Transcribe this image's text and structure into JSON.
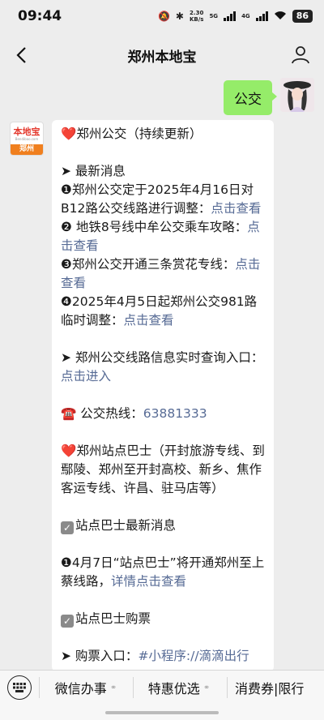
{
  "status": {
    "time": "09:44",
    "net_speed_top": "2.30",
    "net_speed_bottom": "KB/s",
    "sig1": "5G",
    "sig2": "4G",
    "battery": "86"
  },
  "nav": {
    "title": "郑州本地宝"
  },
  "user_message": {
    "text": "公交"
  },
  "bot_avatar": {
    "brand": "本地宝",
    "url": "Bendibao.com",
    "city": "郑州"
  },
  "message": {
    "title": "郑州公交（持续更新）",
    "section1": "最新消息",
    "news": [
      {
        "num": "❶",
        "text": "郑州公交定于2025年4月16日对B12路公交线路进行调整：",
        "link": "点击查看"
      },
      {
        "num": "❷",
        "text": "地铁8号线中牟公交乘车攻略：",
        "link": "点击查看"
      },
      {
        "num": "❸",
        "text": "郑州公交开通三条赏花专线：",
        "link": "点击查看"
      },
      {
        "num": "❹",
        "text": "2025年4月5日起郑州公交981路临时调整：",
        "link": "点击查看"
      }
    ],
    "query_text": "郑州公交线路信息实时查询入口：",
    "query_link": "点击进入",
    "hotline_label": "公交热线：",
    "hotline_number": "63881333",
    "bus_title": "郑州站点巴士（开封旅游专线、到鄢陵、郑州至开封高校、新乡、焦作客运专线、许昌、驻马店等）",
    "bus_news_title": "站点巴士最新消息",
    "bus_news_num": "❶",
    "bus_news_text": "4月7日“站点巴士”将开通郑州至上蔡线路，",
    "bus_news_link": "详情点击查看",
    "ticket_title": "站点巴士购票",
    "ticket_text": "购票入口：",
    "ticket_link": "#小程序://滴滴出行"
  },
  "bottom_menu": {
    "item1": "微信办事",
    "item2": "特惠优选",
    "item3": "消费券|限行"
  }
}
